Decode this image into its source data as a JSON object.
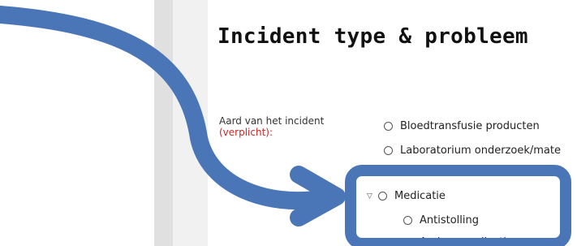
{
  "page": {
    "title": "Incident type & probleem"
  },
  "field": {
    "label": "Aard van het incident",
    "required_marker": "(verplicht):"
  },
  "options": [
    {
      "label": "Bloedtransfusie producten",
      "level": 0,
      "toggle": ""
    },
    {
      "label": "Laboratorium onderzoek/mate",
      "level": 0,
      "toggle": ""
    },
    {
      "label": "Medicatie",
      "level": 0,
      "toggle": "▽"
    },
    {
      "label": "Antistolling",
      "level": 1,
      "toggle": ""
    },
    {
      "label": "Andere medicatie",
      "level": 1,
      "toggle": ""
    }
  ],
  "annotation": {
    "color": "#4a76b8",
    "shape": "curved arrow pointing to highlighted box"
  }
}
